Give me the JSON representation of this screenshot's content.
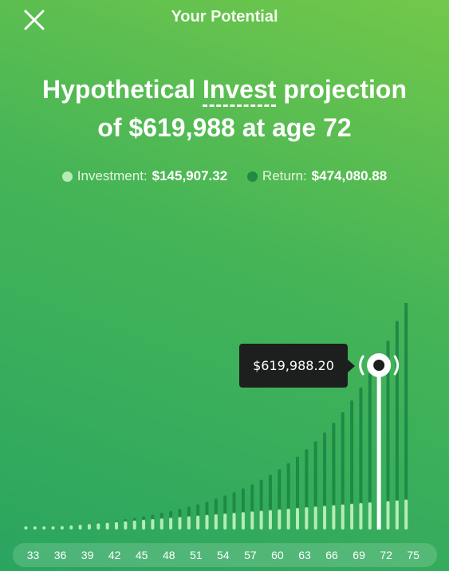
{
  "header": {
    "title": "Your Potential",
    "close_icon": "close-icon"
  },
  "headline": {
    "prefix": "Hypothetical ",
    "link": "Invest",
    "suffix": " projection",
    "line2": "of $619,988 at age 72"
  },
  "legend": {
    "investment_label": "Investment:",
    "investment_value": "$145,907.32",
    "return_label": "Return:",
    "return_value": "$474,080.88"
  },
  "tooltip": {
    "value": "$619,988.20"
  },
  "colors": {
    "investment": "#b5ecb6",
    "return": "#1e8a45",
    "selected": "#ffffff",
    "tooltip_bg": "#1d1f1e"
  },
  "chart_data": {
    "type": "bar",
    "stacked": true,
    "x_label": "age",
    "x": [
      33,
      34,
      35,
      36,
      37,
      38,
      39,
      40,
      41,
      42,
      43,
      44,
      45,
      46,
      47,
      48,
      49,
      50,
      51,
      52,
      53,
      54,
      55,
      56,
      57,
      58,
      59,
      60,
      61,
      62,
      63,
      64,
      65,
      66,
      67,
      68,
      69,
      70,
      71,
      72,
      73,
      74,
      75
    ],
    "x_ticks": [
      "33",
      "36",
      "39",
      "42",
      "45",
      "48",
      "51",
      "54",
      "57",
      "60",
      "63",
      "66",
      "69",
      "72",
      "75"
    ],
    "series": [
      {
        "name": "Investment",
        "values": [
          2400,
          5200,
          7900,
          10600,
          13400,
          16100,
          18900,
          21600,
          24300,
          27100,
          29800,
          32600,
          35300,
          38000,
          40800,
          43500,
          46300,
          49000,
          51700,
          54500,
          57200,
          60000,
          62700,
          65400,
          68200,
          70900,
          73700,
          76400,
          79100,
          81900,
          84600,
          87400,
          90100,
          92800,
          95600,
          98300,
          101100,
          103800,
          106500,
          145907,
          111900,
          114700,
          117500
        ]
      },
      {
        "name": "Return",
        "values": [
          0,
          0,
          0,
          0,
          200,
          500,
          900,
          1500,
          2300,
          3400,
          5500,
          8000,
          11000,
          14300,
          18100,
          22300,
          27000,
          32400,
          38400,
          45300,
          53000,
          61600,
          71300,
          82100,
          94200,
          107700,
          122800,
          139600,
          158400,
          179400,
          202700,
          228600,
          257300,
          289200,
          324600,
          363800,
          407200,
          455300,
          508400,
          474081,
          631400,
          706300,
          788600
        ]
      }
    ],
    "selected_x": 72,
    "selected_total": 619988.2,
    "ylim": [
      0,
      910000
    ]
  }
}
